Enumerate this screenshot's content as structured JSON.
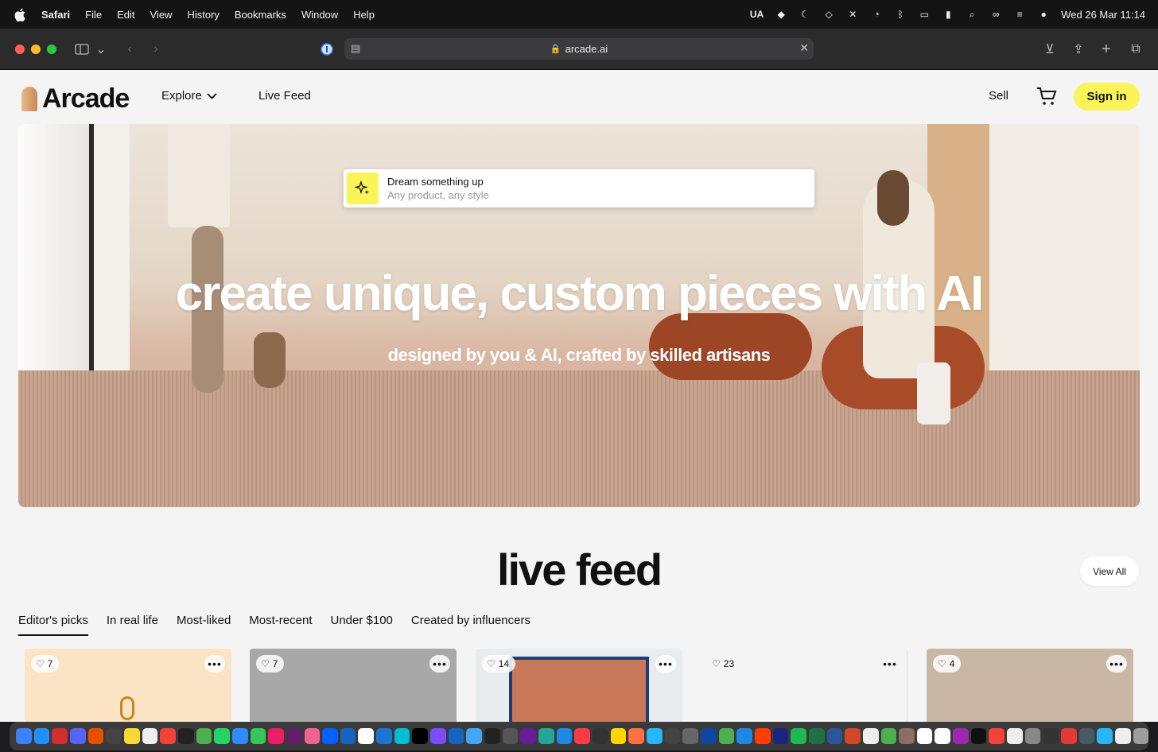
{
  "menubar": {
    "app": "Safari",
    "items": [
      "File",
      "Edit",
      "View",
      "History",
      "Bookmarks",
      "Window",
      "Help"
    ],
    "status_input": "UA",
    "datetime": "Wed 26 Mar  11:14"
  },
  "browser": {
    "url": "arcade.ai"
  },
  "site": {
    "logo": "Arcade",
    "nav": {
      "explore": "Explore",
      "live_feed": "Live Feed",
      "sell": "Sell",
      "sign_in": "Sign in"
    },
    "hero": {
      "prompt_title": "Dream something up",
      "prompt_placeholder": "Any product, any style",
      "title": "create unique, custom pieces with AI",
      "subtitle": "designed by you & AI, crafted by skilled artisans"
    },
    "feed": {
      "title": "live feed",
      "view_all": "View All",
      "tabs": [
        "Editor's picks",
        "In real life",
        "Most-liked",
        "Most-recent",
        "Under $100",
        "Created by influencers"
      ],
      "cards": [
        {
          "likes": "7"
        },
        {
          "likes": "7"
        },
        {
          "likes": "14"
        },
        {
          "likes": "23"
        },
        {
          "likes": "4"
        }
      ]
    }
  },
  "colors": {
    "accent": "#fbf35a",
    "page_bg": "#f4f4f4"
  }
}
